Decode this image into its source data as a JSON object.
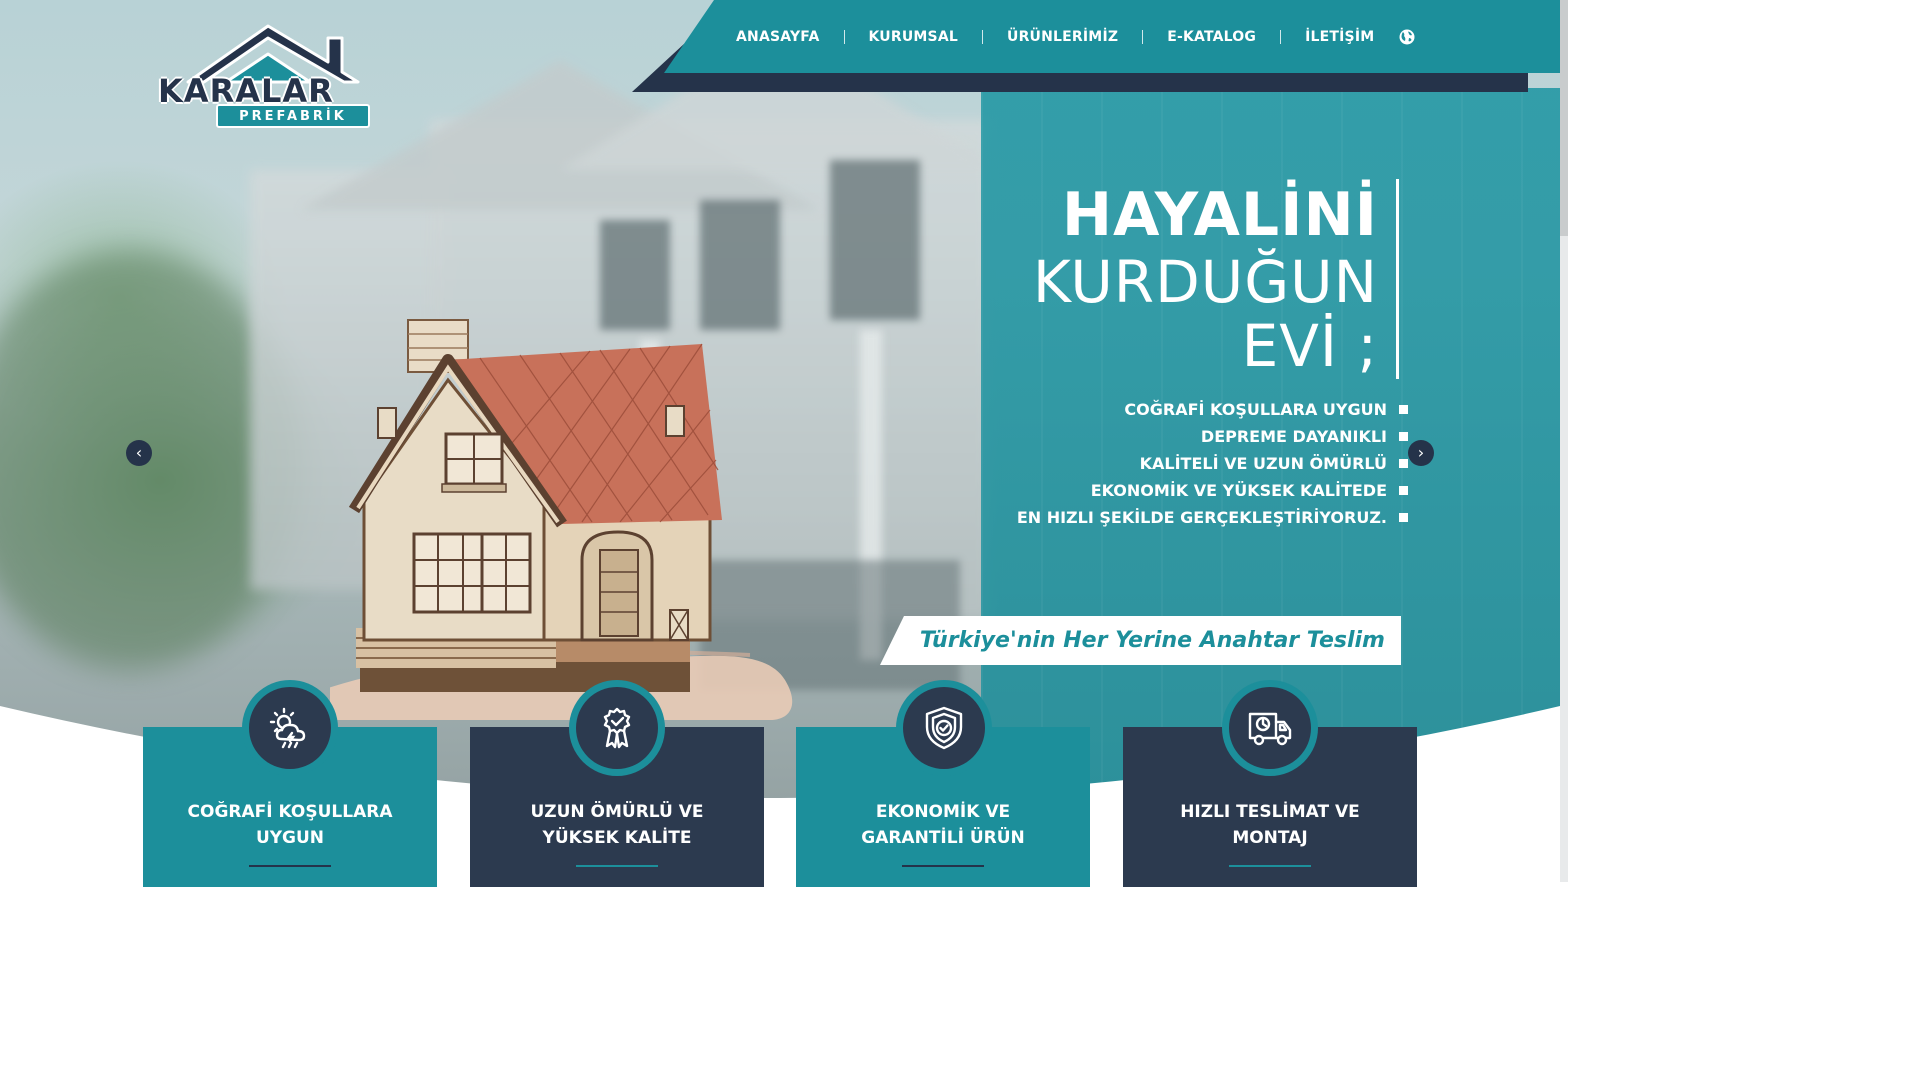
{
  "header": {
    "brand_name": "KARALAR",
    "brand_sub": "PREFABRİK",
    "nav": [
      "ANASAYFA",
      "KURUMSAL",
      "ÜRÜNLERİMİZ",
      "E-KATALOG",
      "İLETİŞİM"
    ],
    "language_icon": "globe-icon"
  },
  "hero": {
    "line1": "HAYALİNİ",
    "line2": "KURDUĞUN",
    "line3": "EVİ ;",
    "features": [
      "COĞRAFİ KOŞULLARA UYGUN",
      "DEPREME DAYANIKLI",
      "KALİTELİ VE UZUN ÖMÜRLÜ",
      "EKONOMİK VE YÜKSEK KALİTEDE",
      "EN HIZLI ŞEKİLDE GERÇEKLEŞTİRİYORUZ."
    ],
    "slogan": "Türkiye'nin Her Yerine Anahtar Teslim",
    "prev_arrow": "‹",
    "next_arrow": "›"
  },
  "cards": [
    {
      "title": "COĞRAFİ KOŞULLARA UYGUN",
      "icon": "weather-icon"
    },
    {
      "title": "UZUN ÖMÜRLÜ VE YÜKSEK KALİTE",
      "icon": "award-ribbon-icon"
    },
    {
      "title": "EKONOMİK VE GARANTİLİ ÜRÜN",
      "icon": "shield-check-icon"
    },
    {
      "title": "HIZLI TESLİMAT VE MONTAJ",
      "icon": "delivery-truck-icon"
    }
  ],
  "colors": {
    "teal": "#1c8f9b",
    "navy": "#2c3a4f",
    "white": "#ffffff"
  }
}
